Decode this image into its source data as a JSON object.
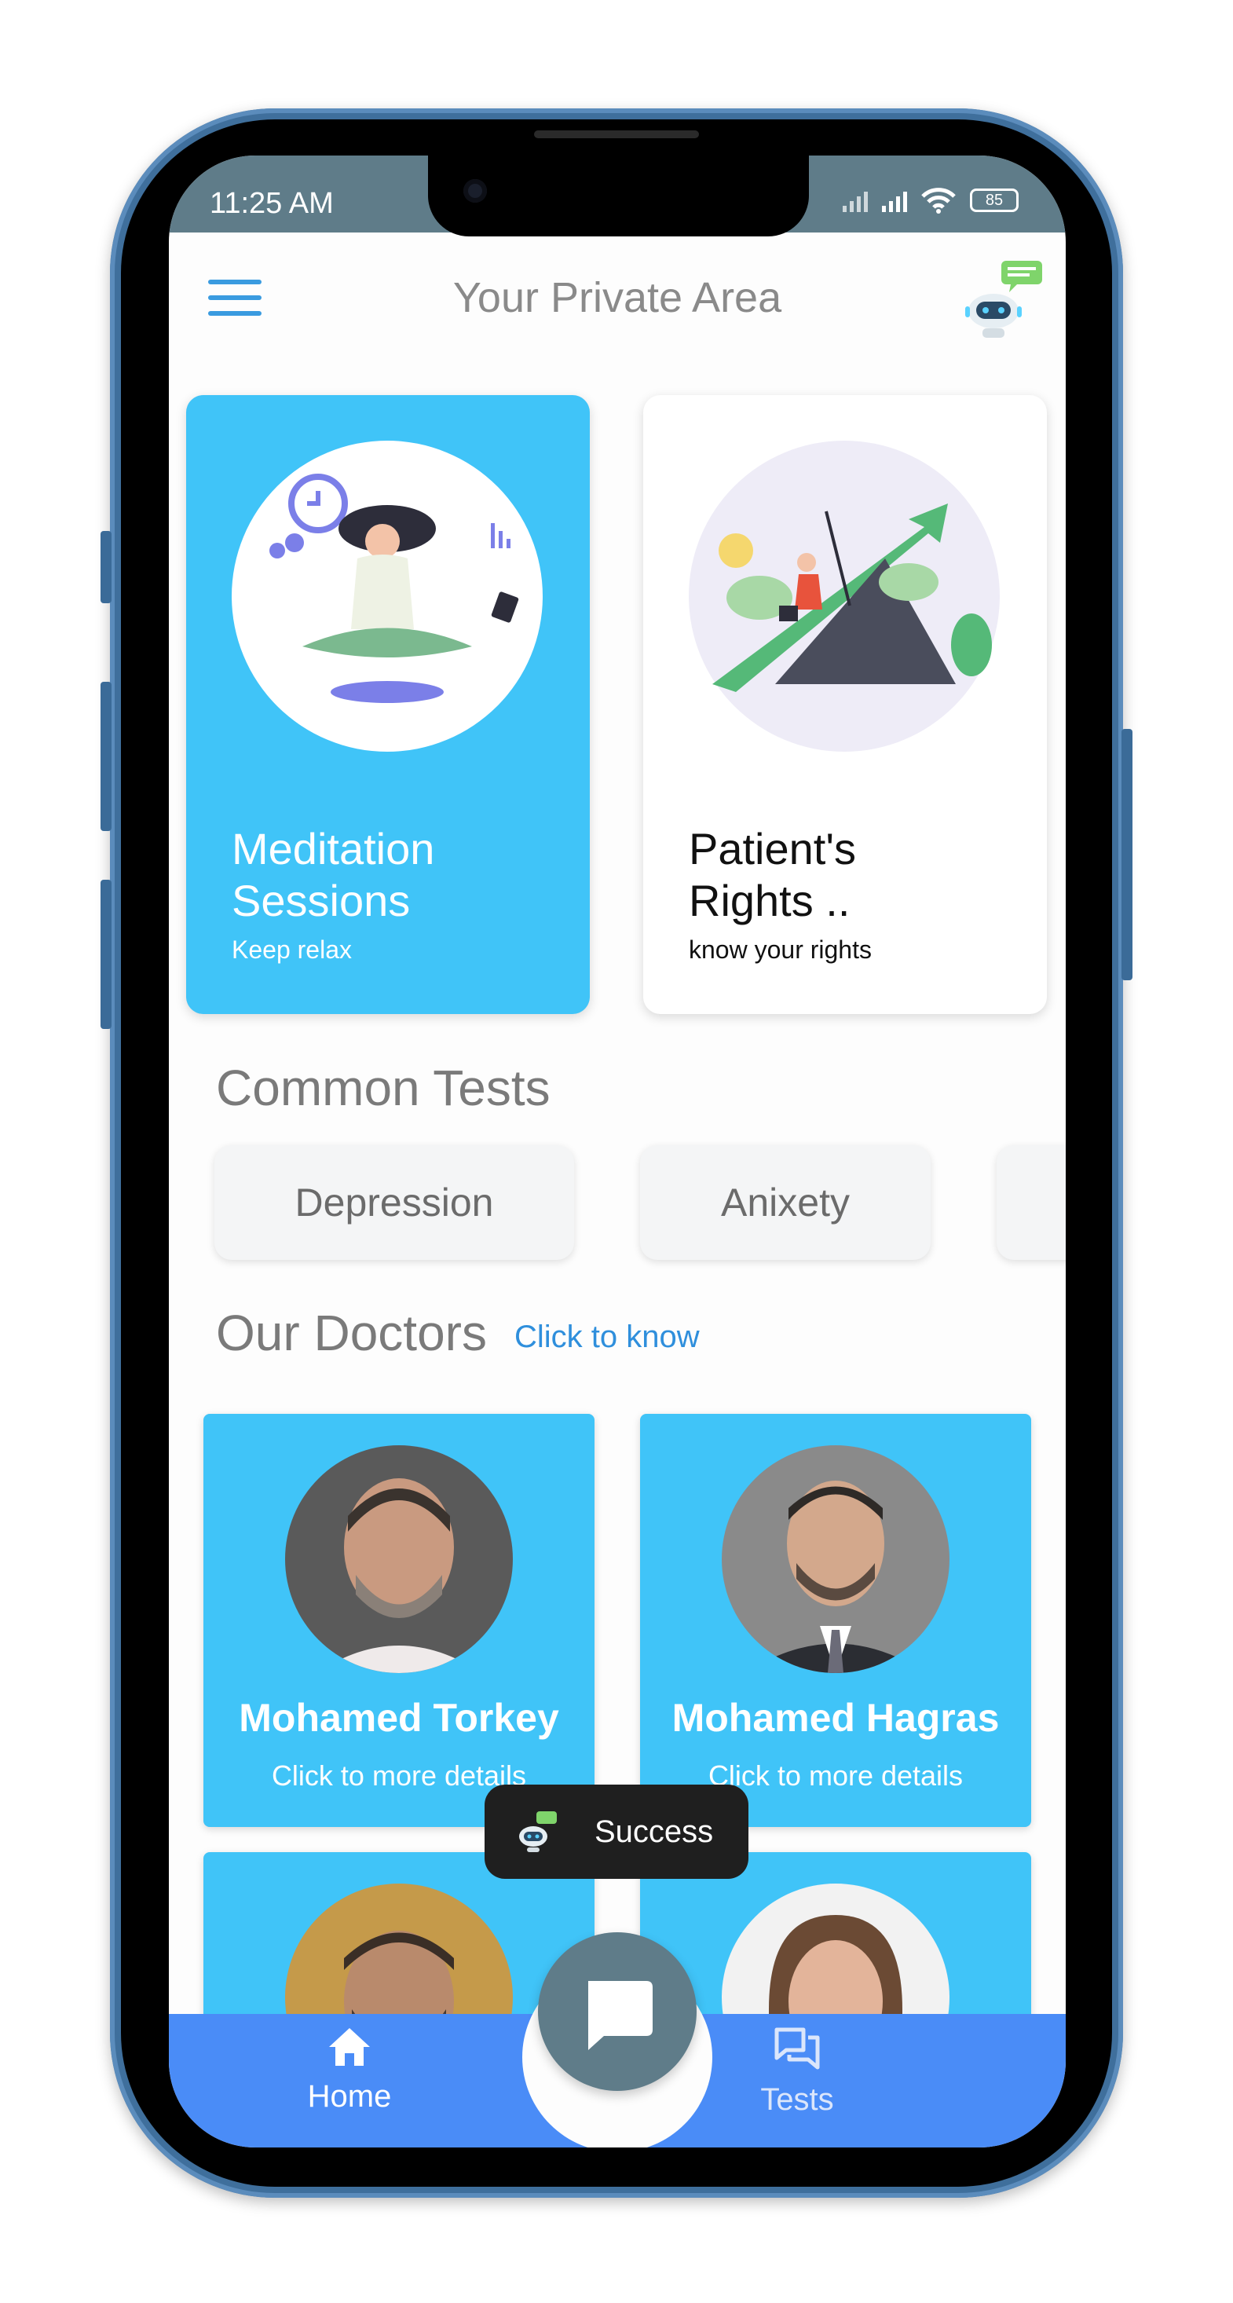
{
  "status": {
    "time": "11:25 AM",
    "battery": "85"
  },
  "header": {
    "title": "Your Private Area"
  },
  "features": [
    {
      "title_line1": "Meditation",
      "title_line2": "Sessions",
      "subtitle": "Keep relax"
    },
    {
      "title_line1": "Patient's",
      "title_line2": "Rights ..",
      "subtitle": "know your rights"
    }
  ],
  "tests": {
    "heading": "Common Tests",
    "items": [
      "Depression",
      "Anixety"
    ]
  },
  "doctors": {
    "heading": "Our Doctors",
    "link": "Click to know",
    "items": [
      {
        "name": "Mohamed Torkey",
        "subtitle": "Click to more details"
      },
      {
        "name": "Mohamed Hagras",
        "subtitle": "Click to more details"
      }
    ]
  },
  "toast": {
    "text": "Success"
  },
  "nav": {
    "home": "Home",
    "tests": "Tests"
  },
  "colors": {
    "card_blue": "#40c4f8",
    "nav_blue": "#4a8cf7",
    "status_gray": "#5f7c89",
    "link_blue": "#2f8fdc"
  }
}
